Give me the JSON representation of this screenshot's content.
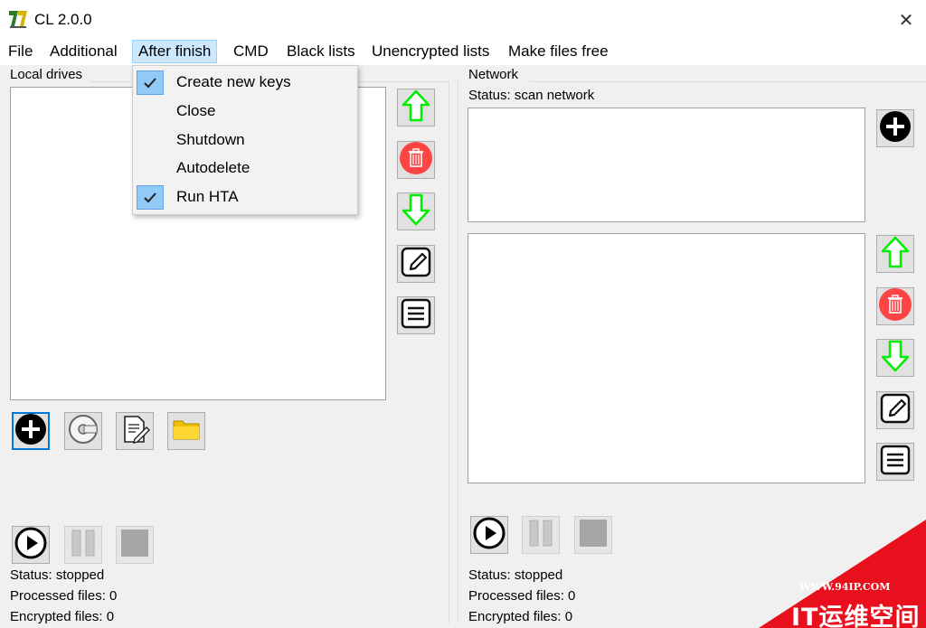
{
  "window": {
    "title": "CL 2.0.0",
    "close_glyph": "✕"
  },
  "menu": {
    "items": [
      {
        "label": "File"
      },
      {
        "label": "Additional"
      },
      {
        "label": "After finish"
      },
      {
        "label": "CMD"
      },
      {
        "label": "Black lists"
      },
      {
        "label": "Unencrypted lists"
      },
      {
        "label": "Make files free"
      }
    ],
    "active": "After finish"
  },
  "dropdown": {
    "items": [
      {
        "label": "Create new keys",
        "checked": true
      },
      {
        "label": "Close",
        "checked": false
      },
      {
        "label": "Shutdown",
        "checked": false
      },
      {
        "label": "Autodelete",
        "checked": false
      },
      {
        "label": "Run HTA",
        "checked": true
      }
    ]
  },
  "left_panel": {
    "title": "Local drives",
    "status": "Status: stopped",
    "processed": "Processed files: 0",
    "encrypted": "Encrypted files: 0"
  },
  "right_panel": {
    "title": "Network",
    "scan_status": "Status: scan network",
    "status": "Status: stopped",
    "processed": "Processed files: 0",
    "encrypted": "Encrypted files: 0"
  },
  "icons": {
    "up": "arrow-up-icon",
    "delete": "trash-icon",
    "down": "arrow-down-icon",
    "edit": "edit-icon",
    "list": "list-icon",
    "add": "plus-icon",
    "drive": "disk-icon",
    "file": "document-icon",
    "folder": "folder-icon",
    "play": "play-icon",
    "pause": "pause-icon",
    "stop": "stop-icon"
  },
  "colors": {
    "arrow_green": "#00ff00",
    "delete_red": "#ff4444",
    "menu_highlight": "#cce8ff",
    "check_highlight": "#91c9f7",
    "watermark_red": "#e8101c"
  },
  "watermark": {
    "line1": "WWW.94IP.COM",
    "line2": "IT运维空间"
  }
}
